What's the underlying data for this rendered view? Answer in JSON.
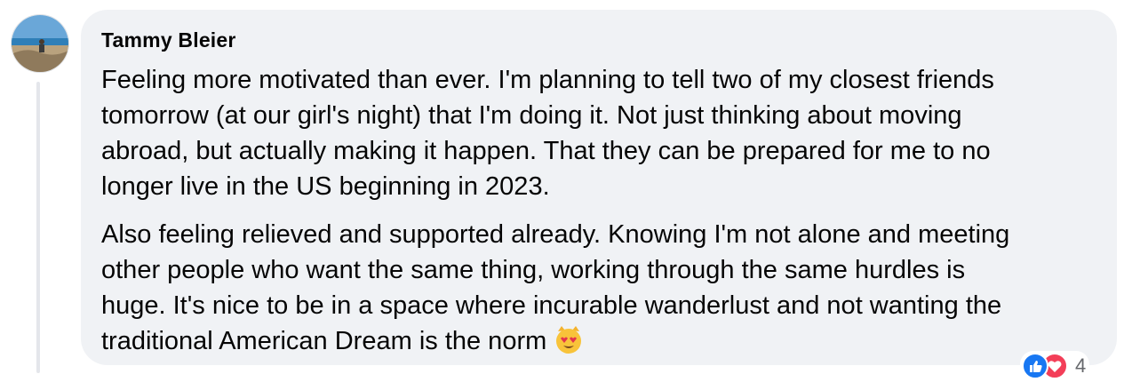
{
  "comment": {
    "author": "Tammy Bleier",
    "paragraphs": [
      {
        "lines": [
          "Feeling more motivated than ever. I'm planning to tell two of my closest friends",
          "tomorrow (at our girl's night) that I'm doing it. Not just thinking about moving",
          "abroad, but actually making it happen. That they can be prepared for me to no",
          "longer live in the US beginning in 2023."
        ]
      },
      {
        "lines": [
          "Also feeling relieved and supported already. Knowing I'm not alone and meeting",
          "other people who want the same thing, working through the same hurdles is",
          "huge. It's nice to be in a space where incurable wanderlust and not wanting the",
          "traditional American Dream is the norm"
        ]
      }
    ],
    "trailing_emoji": "heart-eyes-cat-icon",
    "reactions": {
      "icons": [
        "like-icon",
        "love-icon"
      ],
      "count": "4"
    }
  },
  "colors": {
    "bubble": "#f0f2f5",
    "text": "#050505",
    "like": "#1877f2",
    "love": "#f33e58",
    "muted": "#65676b"
  }
}
